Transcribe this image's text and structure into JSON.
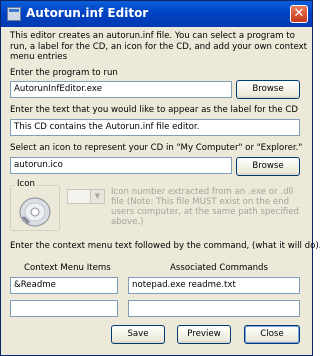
{
  "window": {
    "title": "Autorun.inf Editor",
    "close_glyph": "✕"
  },
  "intro": "This editor creates an autorun.inf file.  You can select a program to run, a label for the CD, an icon for the CD,  and add your own context menu entries",
  "program": {
    "label": "Enter the program to run",
    "value": "AutorunInfEditor.exe",
    "browse": "Browse"
  },
  "cd_label": {
    "label": "Enter the text that you would like to appear as the label for the CD",
    "value": "This CD contains the Autorun.inf file editor."
  },
  "icon": {
    "label": "Select an icon to represent your CD in \"My Computer\" or \"Explorer.\"",
    "value": "autorun.ico",
    "browse": "Browse",
    "group_title": "Icon",
    "index_note": "Icon number extracted from an .exe or .dll file (Note: This file MUST exist on the end users computer, at the same path specified above.)",
    "index_value": ""
  },
  "context_menu": {
    "instruction": "Enter the context menu text followed by the command, (what it will do).",
    "items_header": "Context Menu Items",
    "commands_header": "Associated Commands",
    "rows": [
      {
        "item": "&Readme",
        "command": "notepad.exe readme.txt"
      },
      {
        "item": "",
        "command": ""
      }
    ]
  },
  "buttons": {
    "save": "Save",
    "preview": "Preview",
    "close": "Close"
  },
  "colors": {
    "titlebar": "#0a5fd8",
    "window_bg": "#ece9d8",
    "close_button": "#c2381b"
  }
}
